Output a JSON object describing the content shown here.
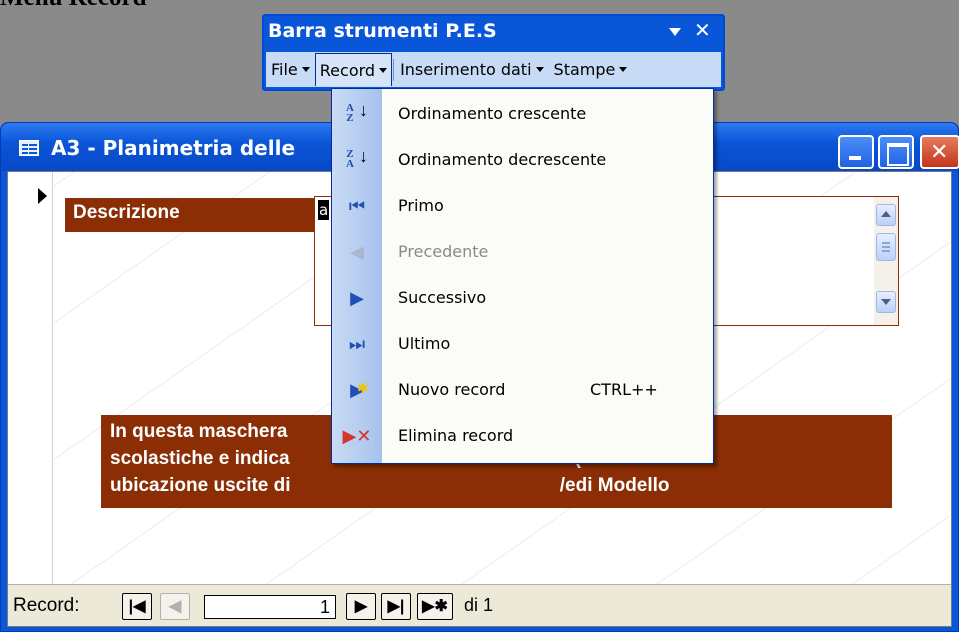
{
  "heading": "Menu Record",
  "form": {
    "title": "A3 - Planimetria delle",
    "label_descrizione": "Descrizione",
    "field_value": "a",
    "info_lines": [
      "In questa maschera                                                     nimetrie",
      "scolastiche e indica                                                   e (es.",
      "ubicazione uscite di                                                   /edi Modello"
    ],
    "nav": {
      "label": "Record:",
      "current": "1",
      "of_text": "di 1"
    }
  },
  "toolbar": {
    "title": "Barra strumenti P.E.S",
    "menus": [
      "File",
      "Record",
      "Inserimento dati",
      "Stampe"
    ]
  },
  "dropdown": {
    "items": [
      {
        "label": "Ordinamento crescente",
        "icon": "sort-ascending-icon",
        "enabled": true
      },
      {
        "label": "Ordinamento decrescente",
        "icon": "sort-descending-icon",
        "enabled": true
      },
      {
        "label": "Primo",
        "icon": "first-record-icon",
        "enabled": true
      },
      {
        "label": "Precedente",
        "icon": "previous-record-icon",
        "enabled": false
      },
      {
        "label": "Successivo",
        "icon": "next-record-icon",
        "enabled": true
      },
      {
        "label": "Ultimo",
        "icon": "last-record-icon",
        "enabled": true
      },
      {
        "label": "Nuovo record",
        "icon": "new-record-icon",
        "enabled": true,
        "shortcut": "CTRL++"
      },
      {
        "label": "Elimina record",
        "icon": "delete-record-icon",
        "enabled": true
      }
    ]
  }
}
